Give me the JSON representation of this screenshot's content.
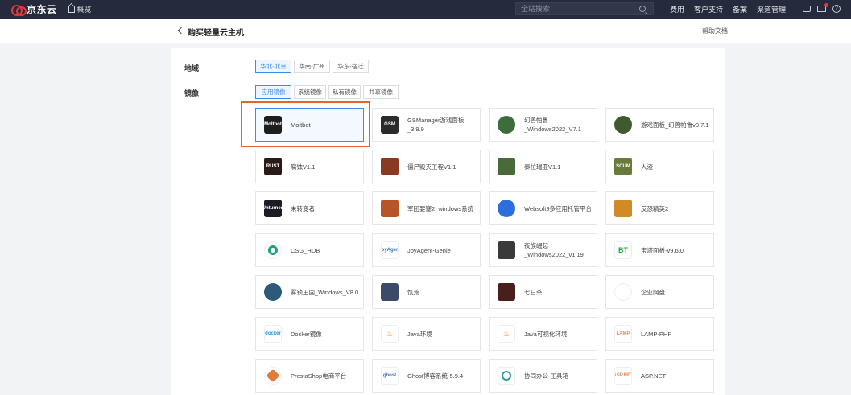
{
  "nav": {
    "brand": "京东云",
    "overview": "概览",
    "search_placeholder": "全站搜索",
    "links": [
      "费用",
      "客户支持",
      "备案",
      "渠道管理"
    ]
  },
  "header": {
    "back_icon": "chevron-left-icon",
    "title": "购买轻量云主机",
    "help": "帮助文档"
  },
  "region": {
    "label": "地域",
    "options": [
      "华北-北京",
      "华南-广州",
      "华东-宿迁"
    ],
    "selected": "华北-北京"
  },
  "image": {
    "label": "镜像",
    "tabs": [
      "应用镜像",
      "系统镜像",
      "私有镜像",
      "共享镜像"
    ],
    "selected_tab": "应用镜像",
    "selected_card": "Moltbot",
    "cards": [
      {
        "name": "Moltbot",
        "logo": "moltbot-logo",
        "logo_text": "Moltbot",
        "color": "#1e1e1e"
      },
      {
        "name": "GSManager游戏面板\n_3.9.9",
        "logo": "gsm-logo",
        "logo_text": "GSM",
        "color": "#2b2b2b"
      },
      {
        "name": "幻兽帕鲁\n_Windows2022_V7.1",
        "logo": "palworld-logo",
        "logo_text": "",
        "color": "#3b6e3a"
      },
      {
        "name": "游戏面板_幻兽帕鲁v0.7.1",
        "logo": "palworld-panel-logo",
        "logo_text": "",
        "color": "#3f5a2e"
      },
      {
        "name": "腐蚀V1.1",
        "logo": "rust-logo",
        "logo_text": "RUST",
        "color": "#2a1a18"
      },
      {
        "name": "僵尸毁灭工程V1.1",
        "logo": "zomboid-logo",
        "logo_text": "",
        "color": "#8a3a22"
      },
      {
        "name": "泰拉瑞亚V1.1",
        "logo": "terraria-logo",
        "logo_text": "",
        "color": "#4a6a3a"
      },
      {
        "name": "人渣",
        "logo": "scum-logo",
        "logo_text": "SCUM",
        "color": "#6a7a3a"
      },
      {
        "name": "未转变者",
        "logo": "unturned-logo",
        "logo_text": "Unturned",
        "color": "#1c1c24"
      },
      {
        "name": "军团要塞2_windows系统",
        "logo": "tf2-logo",
        "logo_text": "",
        "color": "#b5552a"
      },
      {
        "name": "Websoft9多应用托管平台",
        "logo": "websoft9-logo",
        "logo_text": "",
        "color": "#2c6fdc"
      },
      {
        "name": "反恐精英2",
        "logo": "cs2-logo",
        "logo_text": "",
        "color": "#d08a28"
      },
      {
        "name": "CSG_HUB",
        "logo": "csghub-logo",
        "logo_text": "",
        "color": "#ffffff"
      },
      {
        "name": "JoyAgent-Genie",
        "logo": "joyagent-logo",
        "logo_text": "JoyAgent",
        "color": "#ffffff"
      },
      {
        "name": "夜族崛起\n_Windows2022_v1.19",
        "logo": "vrising-logo",
        "logo_text": "",
        "color": "#3a3a3a"
      },
      {
        "name": "宝塔面板-v9.6.0",
        "logo": "bt-logo",
        "logo_text": "BT",
        "color": "#ffffff"
      },
      {
        "name": "雾锁王国_Windows_V8.0",
        "logo": "enshrouded-logo",
        "logo_text": "",
        "color": "#2c5a78"
      },
      {
        "name": "饥荒",
        "logo": "dontstarve-logo",
        "logo_text": "",
        "color": "#3c4a6a"
      },
      {
        "name": "七日杀",
        "logo": "7dtd-logo",
        "logo_text": "",
        "color": "#4a1e1a"
      },
      {
        "name": "企业网盘",
        "logo": "cloud-drive-logo",
        "logo_text": "",
        "color": "#ffffff"
      },
      {
        "name": "Docker镜像",
        "logo": "docker-logo",
        "logo_text": "docker",
        "color": "#ffffff"
      },
      {
        "name": "Java环境",
        "logo": "java-logo",
        "logo_text": "",
        "color": "#ffffff"
      },
      {
        "name": "Java可视化环境",
        "logo": "java-visual-logo",
        "logo_text": "",
        "color": "#ffffff"
      },
      {
        "name": "LAMP-PHP",
        "logo": "lamp-logo",
        "logo_text": "LAMP",
        "color": "#ffffff"
      },
      {
        "name": "PrestaShop电商平台",
        "logo": "prestashop-logo",
        "logo_text": "",
        "color": "#ffffff"
      },
      {
        "name": "Ghost博客系统-5.9.4",
        "logo": "ghost-logo",
        "logo_text": "ghost",
        "color": "#ffffff"
      },
      {
        "name": "协同办公-工具箱",
        "logo": "office-logo",
        "logo_text": "",
        "color": "#ffffff"
      },
      {
        "name": "ASP.NET",
        "logo": "aspnet-logo",
        "logo_text": "ASP.NET",
        "color": "#ffffff"
      }
    ]
  },
  "colors": {
    "accent": "#3c8cf0",
    "highlight": "#e8622c",
    "brand": "#e4393c",
    "nav_bg": "#252a3c"
  }
}
